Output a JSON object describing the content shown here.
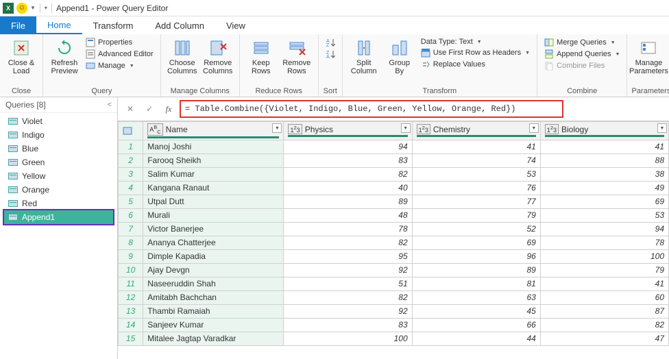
{
  "titlebar": {
    "title": "Append1 - Power Query Editor"
  },
  "tabs": {
    "file": "File",
    "home": "Home",
    "transform": "Transform",
    "add_column": "Add Column",
    "view": "View"
  },
  "ribbon": {
    "close": {
      "close_load": "Close &\nLoad",
      "group": "Close"
    },
    "query": {
      "refresh": "Refresh\nPreview",
      "properties": "Properties",
      "advanced": "Advanced Editor",
      "manage": "Manage",
      "group": "Query"
    },
    "manage_cols": {
      "choose": "Choose\nColumns",
      "remove": "Remove\nColumns",
      "group": "Manage Columns"
    },
    "reduce": {
      "keep": "Keep\nRows",
      "remove": "Remove\nRows",
      "group": "Reduce Rows"
    },
    "sort": {
      "group": "Sort"
    },
    "transform": {
      "split": "Split\nColumn",
      "groupby": "Group\nBy",
      "datatype": "Data Type: Text",
      "firstrow": "Use First Row as Headers",
      "replace": "Replace Values",
      "group": "Transform"
    },
    "combine": {
      "merge": "Merge Queries",
      "append": "Append Queries",
      "combine_files": "Combine Files",
      "group": "Combine"
    },
    "params": {
      "manage": "Manage\nParameters",
      "group": "Parameters"
    }
  },
  "queries_pane": {
    "header": "Queries [8]",
    "items": [
      "Violet",
      "Indigo",
      "Blue",
      "Green",
      "Yellow",
      "Orange",
      "Red",
      "Append1"
    ],
    "selected_index": 7
  },
  "formula": "= Table.Combine({Violet, Indigo, Blue, Green, Yellow, Orange, Red})",
  "grid": {
    "columns": [
      {
        "type": "ABC",
        "name": "Name"
      },
      {
        "type": "123",
        "name": "Physics"
      },
      {
        "type": "123",
        "name": "Chemistry"
      },
      {
        "type": "123",
        "name": "Biology"
      }
    ],
    "rows": [
      {
        "n": 1,
        "name": "Manoj Joshi",
        "p": 94,
        "c": 41,
        "b": 41
      },
      {
        "n": 2,
        "name": "Farooq Sheikh",
        "p": 83,
        "c": 74,
        "b": 88
      },
      {
        "n": 3,
        "name": "Salim Kumar",
        "p": 82,
        "c": 53,
        "b": 38
      },
      {
        "n": 4,
        "name": "Kangana Ranaut",
        "p": 40,
        "c": 76,
        "b": 49
      },
      {
        "n": 5,
        "name": "Utpal Dutt",
        "p": 89,
        "c": 77,
        "b": 69
      },
      {
        "n": 6,
        "name": "Murali",
        "p": 48,
        "c": 79,
        "b": 53
      },
      {
        "n": 7,
        "name": "Victor Banerjee",
        "p": 78,
        "c": 52,
        "b": 94
      },
      {
        "n": 8,
        "name": "Ananya Chatterjee",
        "p": 82,
        "c": 69,
        "b": 78
      },
      {
        "n": 9,
        "name": "Dimple Kapadia",
        "p": 95,
        "c": 96,
        "b": 100
      },
      {
        "n": 10,
        "name": "Ajay Devgn",
        "p": 92,
        "c": 89,
        "b": 79
      },
      {
        "n": 11,
        "name": "Naseeruddin Shah",
        "p": 51,
        "c": 81,
        "b": 41
      },
      {
        "n": 12,
        "name": "Amitabh Bachchan",
        "p": 82,
        "c": 63,
        "b": 60
      },
      {
        "n": 13,
        "name": "Thambi Ramaiah",
        "p": 92,
        "c": 45,
        "b": 87
      },
      {
        "n": 14,
        "name": "Sanjeev Kumar",
        "p": 83,
        "c": 66,
        "b": 82
      },
      {
        "n": 15,
        "name": "Mitalee Jagtap Varadkar",
        "p": 100,
        "c": 44,
        "b": 47
      }
    ]
  }
}
